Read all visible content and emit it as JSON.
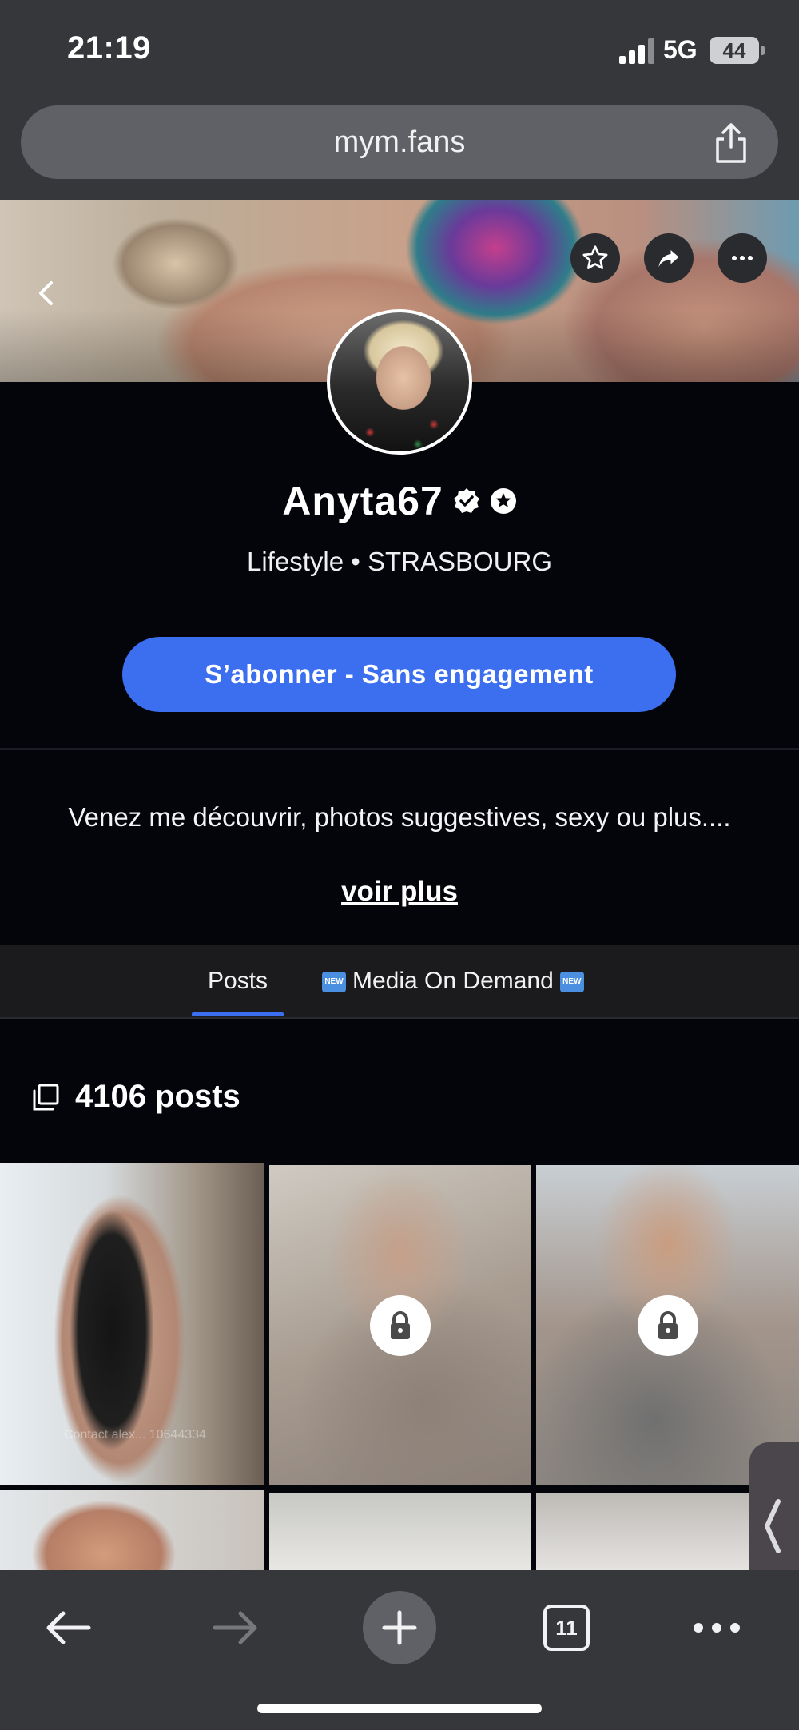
{
  "status_bar": {
    "time": "21:19",
    "network": "5G",
    "battery": "44"
  },
  "browser": {
    "url": "mym.fans"
  },
  "profile": {
    "name": "Anyta67",
    "subtitle": "Lifestyle • STRASBOURG",
    "subscribe_label": "S’abonner - Sans engagement",
    "bio": "Venez me découvrir, photos suggestives, sexy ou plus....",
    "see_more_label": "voir plus"
  },
  "tabs": [
    {
      "label": "Posts",
      "active": true
    },
    {
      "label": "Media On Demand",
      "active": false,
      "badge": "NEW"
    }
  ],
  "posts": {
    "count_label": "4106 posts"
  },
  "grid": [
    {
      "locked": false,
      "watermark": "Contact alex... 10644334"
    },
    {
      "locked": true
    },
    {
      "locked": true
    },
    {
      "locked": false
    },
    {
      "locked": false
    },
    {
      "locked": false
    }
  ],
  "toolbar": {
    "tabs_count": "11"
  },
  "icons": {
    "back": "chevron-left-icon",
    "favorite": "star-icon",
    "share": "share-arrow-icon",
    "more": "ellipsis-icon",
    "verified": "verified-badge-icon",
    "star_badge": "star-badge-icon",
    "posts": "copy-icon",
    "lock": "lock-icon"
  },
  "colors": {
    "accent": "#3b6ff0",
    "background": "#04040b",
    "chrome": "#36373b"
  }
}
